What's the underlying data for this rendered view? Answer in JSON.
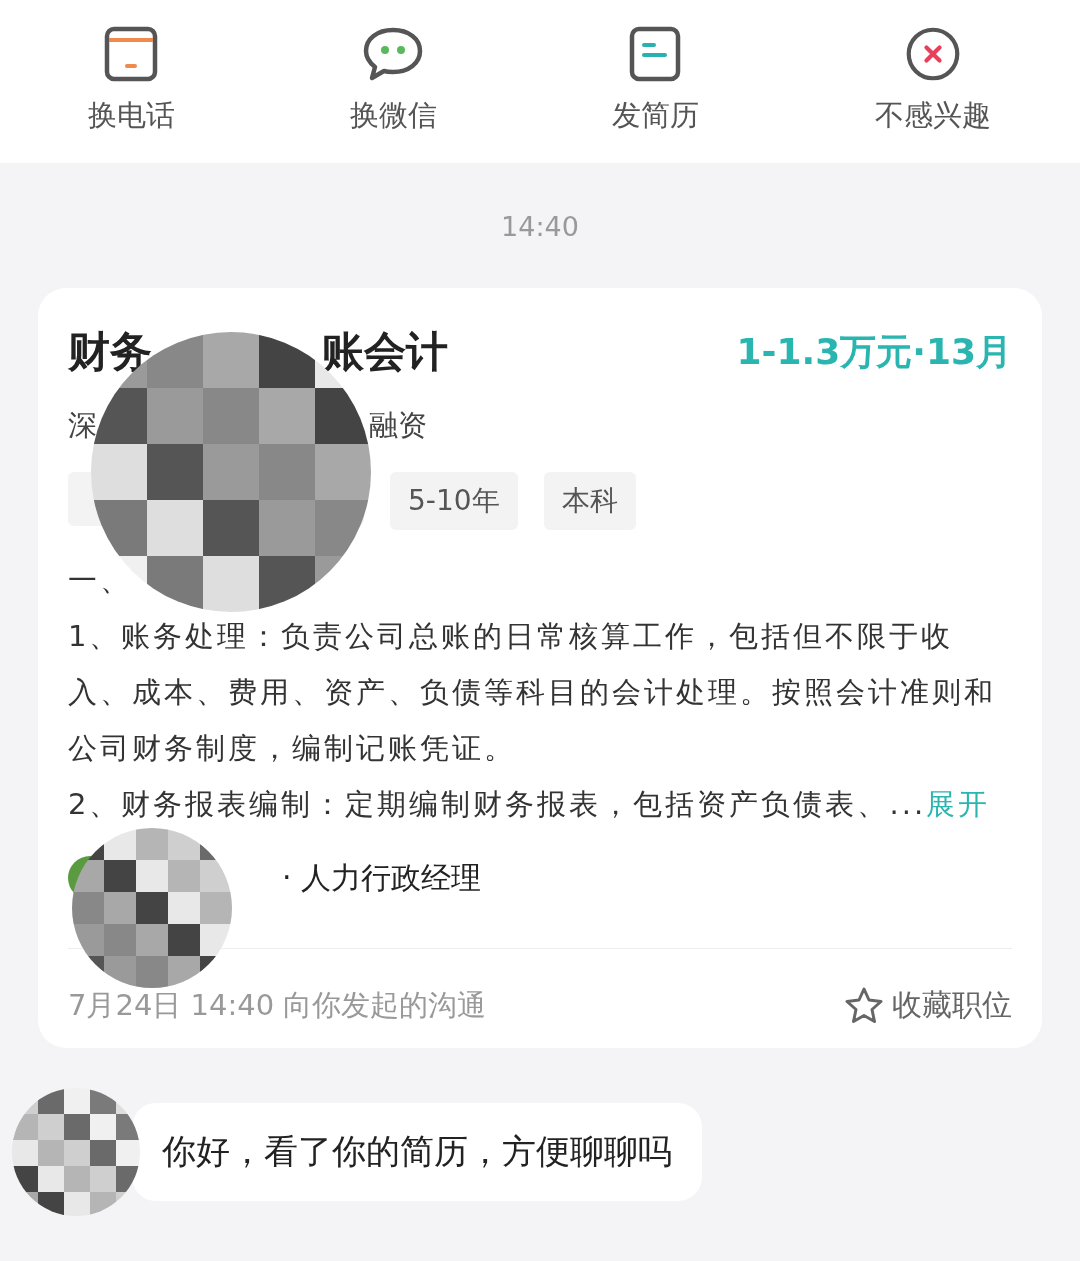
{
  "actions": [
    {
      "kind": "phone",
      "label": "换电话"
    },
    {
      "kind": "wechat",
      "label": "换微信"
    },
    {
      "kind": "resume",
      "label": "发简历"
    },
    {
      "kind": "reject",
      "label": "不感兴趣"
    }
  ],
  "timestamp": "14:40",
  "job_card": {
    "title_parts": [
      "财务",
      "账会计"
    ],
    "salary": "1-1.3万元·13月",
    "company_parts": [
      "深",
      "融资"
    ],
    "tags": [
      "5-10年",
      "本科"
    ],
    "description": [
      "一、",
      "1、账务处理：负责公司总账的日常核算工作，包括但不限于收入、成本、费用、资产、负债等科目的会计处理。按照会计准则和公司财务制度，编制记账凭证。",
      "2、财务报表编制：定期编制财务报表，包括资产负债表、..."
    ],
    "expand_link": "展开",
    "recruiter": "· 人力行政经理",
    "footer_note": "7月24日 14:40 向你发起的沟通",
    "save_label": "收藏职位"
  },
  "messages": [
    {
      "text": "你好，看了你的简历，方便聊聊吗"
    }
  ]
}
